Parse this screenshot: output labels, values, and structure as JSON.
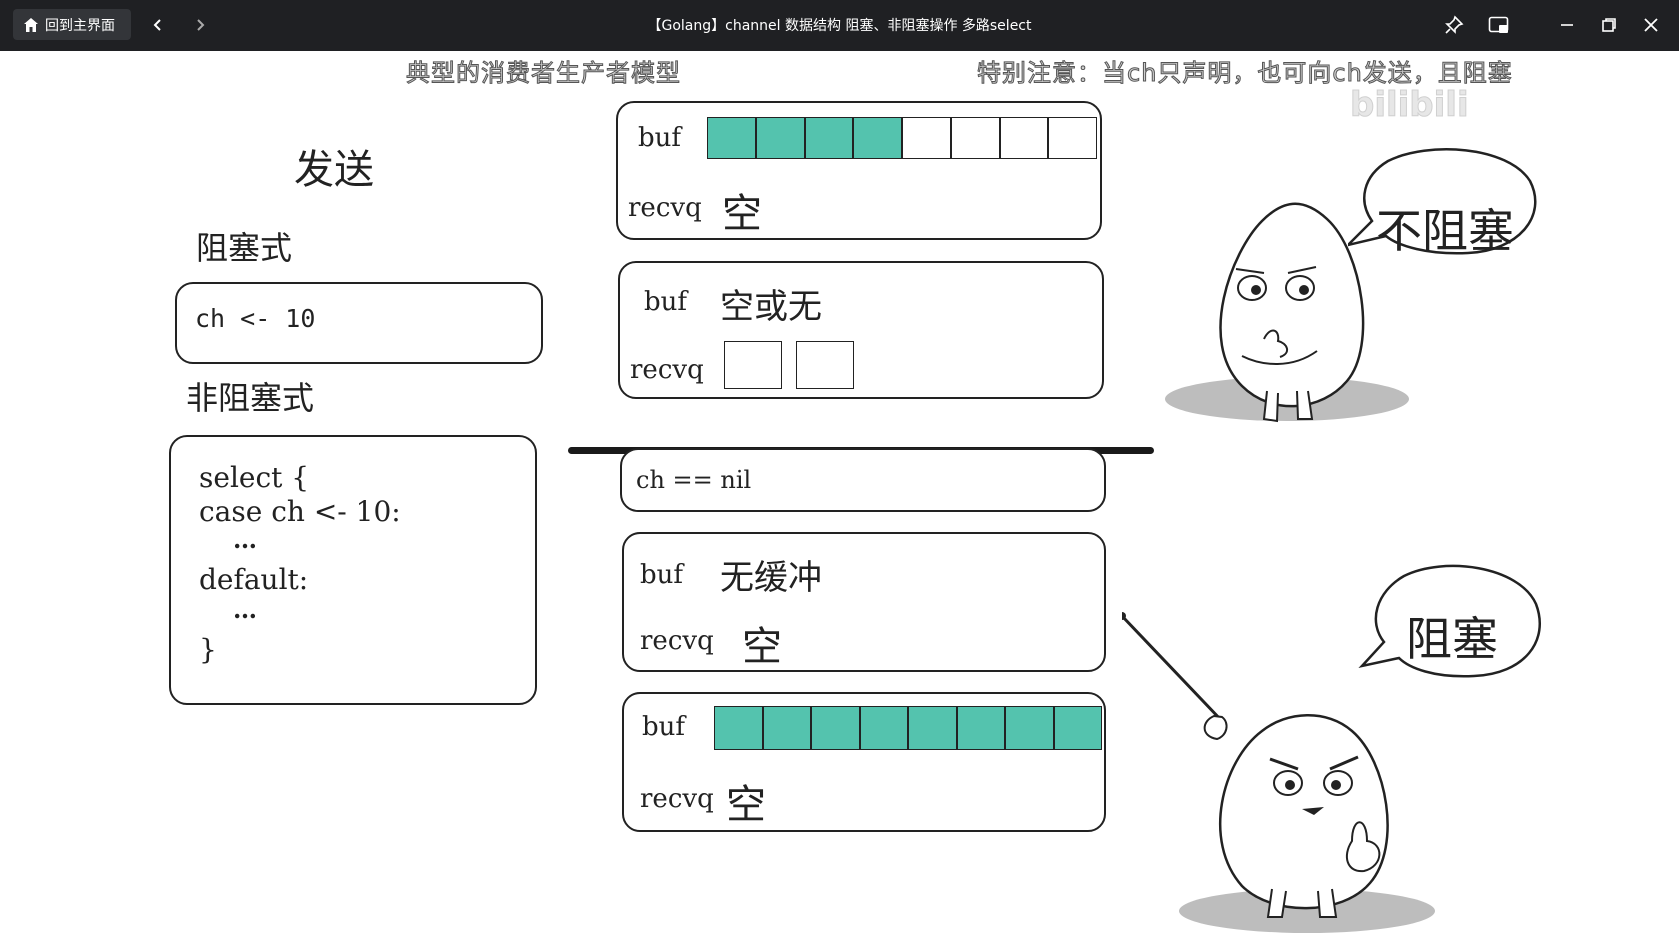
{
  "titlebar": {
    "home_label": "回到主界面",
    "title": "【Golang】channel 数据结构 阻塞、非阻塞操作 多路select"
  },
  "icons": [
    "home-icon",
    "back-icon",
    "forward-icon",
    "pin-icon",
    "pip-icon",
    "minimize-icon",
    "maximize-icon",
    "close-icon"
  ],
  "subtitles": {
    "left": "典型的消费者生产者模型",
    "right": "特别注意：当ch只声明，也可向ch发送，且阻塞"
  },
  "watermark": "bilibili",
  "left_panel": {
    "title": "发送",
    "blocking_label": "阻塞式",
    "blocking_code": "ch <- 10",
    "nonblocking_label": "非阻塞式",
    "nonblocking_code": [
      "select {",
      "case ch <- 10:",
      "…",
      "default:",
      "…",
      "}"
    ]
  },
  "cases": {
    "c1": {
      "buf": "buf",
      "recvq": "recvq",
      "recvq_value": "空",
      "buf_cells": 8,
      "buf_filled": 4
    },
    "c2": {
      "buf": "buf",
      "buf_value": "空或无",
      "recvq": "recvq",
      "recvq_cells": 2
    },
    "c3": {
      "code": "ch == nil"
    },
    "c4": {
      "buf": "buf",
      "buf_value": "无缓冲",
      "recvq": "recvq",
      "recvq_value": "空"
    },
    "c5": {
      "buf": "buf",
      "recvq": "recvq",
      "recvq_value": "空",
      "buf_cells": 8,
      "buf_filled": 8
    }
  },
  "bubbles": {
    "top": "不阻塞",
    "bottom": "阻塞"
  },
  "colors": {
    "buffer_fill": "#54c3ae",
    "titlebar": "#1f2023"
  }
}
